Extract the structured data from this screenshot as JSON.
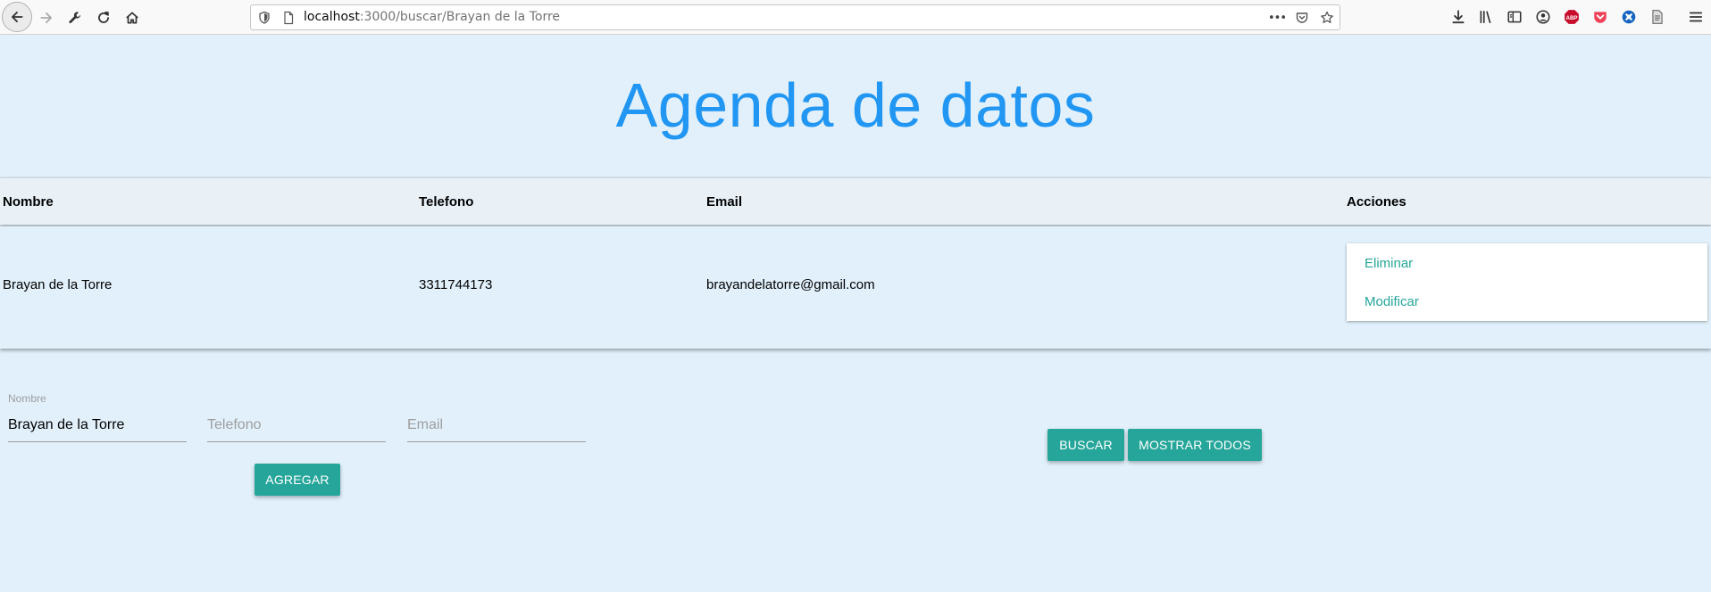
{
  "browser": {
    "url_host": "localhost",
    "url_path": ":3000/buscar/Brayan de la Torre",
    "url_more": "•••",
    "extensions": [
      "download-icon",
      "library-icon",
      "sidebar-icon",
      "account-icon",
      "adblock-icon",
      "pocket-icon",
      "extension-icon",
      "reader-icon",
      "menu-icon"
    ],
    "adblock_label": "ABP"
  },
  "page": {
    "title": "Agenda de datos"
  },
  "table": {
    "headers": {
      "nombre": "Nombre",
      "telefono": "Telefono",
      "email": "Email",
      "acciones": "Acciones"
    },
    "rows": [
      {
        "nombre": "Brayan de la Torre",
        "telefono": "3311744173",
        "email": "brayandelatorre@gmail.com",
        "actions": [
          "Eliminar",
          "Modificar"
        ]
      }
    ]
  },
  "form": {
    "nombre": {
      "label": "Nombre",
      "value": "Brayan de la Torre",
      "placeholder": "Nombre"
    },
    "telefono": {
      "value": "",
      "placeholder": "Telefono"
    },
    "email": {
      "value": "",
      "placeholder": "Email"
    },
    "agregar_label": "AGREGAR",
    "buscar_label": "BUSCAR",
    "mostrar_todos_label": "MOSTRAR TODOS"
  },
  "colors": {
    "accent": "#26a69a",
    "title": "#2196f3",
    "background": "#e1f0fb"
  }
}
